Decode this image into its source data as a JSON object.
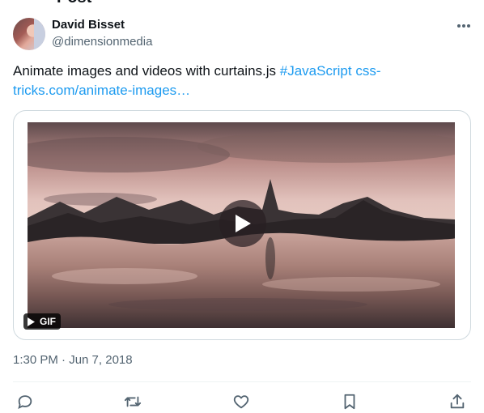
{
  "header": {
    "cut_title": "Post"
  },
  "author": {
    "name": "David Bisset",
    "handle": "@dimensionmedia"
  },
  "tweet": {
    "text_plain": "Animate images and videos with curtains.js ",
    "hashtag": "#JavaScript",
    "link": "css-tricks.com/animate-images…"
  },
  "media": {
    "badge": "GIF"
  },
  "meta": {
    "timestamp": "1:30 PM · Jun 7, 2018"
  },
  "icons": {
    "more": "more-horizontal-icon",
    "reply": "reply-icon",
    "retweet": "retweet-icon",
    "like": "heart-icon",
    "bookmark": "bookmark-icon",
    "share": "share-icon",
    "play": "play-icon"
  },
  "colors": {
    "accent": "#1d9bf0",
    "text": "#0f1419",
    "muted": "#536471",
    "border": "#cfd9de"
  }
}
